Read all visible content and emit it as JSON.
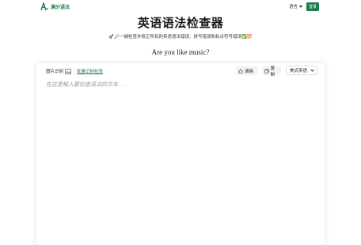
{
  "header": {
    "brand": "满分语法",
    "language_label": "语言",
    "login_label": "登录"
  },
  "hero": {
    "title": "英语语法检查器",
    "subtitle": "🚀🔎一键检查并修正所有的英语语法错误、拼写错误和标点符号错误✅💯",
    "example": "Are you like music?"
  },
  "editor": {
    "image_recognition_label": "图片识别",
    "batch_check_label": "批量识别检查",
    "clear_label": "清除",
    "copy_label": "复制",
    "dialect_value": "美式英语",
    "placeholder": "在这里输入要检查语法的文本. . ."
  },
  "colors": {
    "brand_green": "#1f7a4d",
    "link_green": "#1f7a4d"
  },
  "icons": {
    "logo": "logo-icon",
    "image": "image-icon",
    "clear": "eraser-icon",
    "copy": "copy-icon",
    "chevron": "chevron-down-icon"
  }
}
